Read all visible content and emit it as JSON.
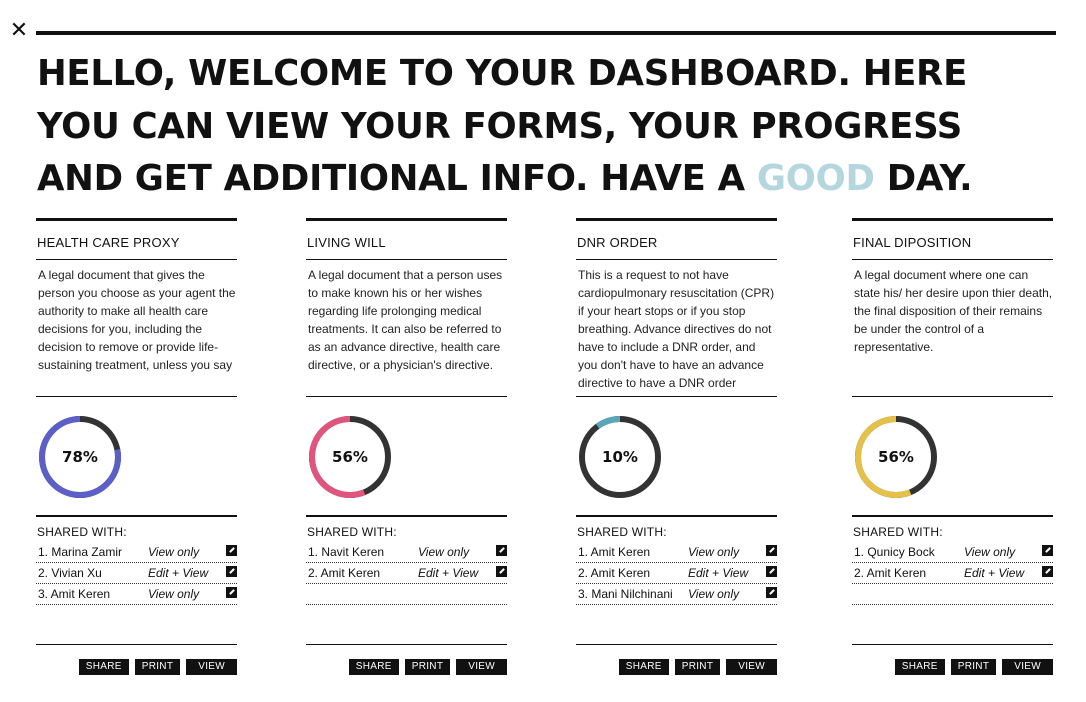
{
  "close_icon": "close-icon",
  "headline": {
    "before": "HELLO, WELCOME TO YOUR DASHBOARD. HERE YOU CAN VIEW YOUR FORMS, YOUR PROGRESS AND GET ADDITIONAL INFO. HAVE A ",
    "accent": "GOOD",
    "after": " DAY."
  },
  "colors": {
    "accent": "#b4d7df",
    "health_care_proxy": "#5b5fc7",
    "living_will": "#e0547e",
    "dnr_order": "#5ba6b8",
    "final_disposition": "#e6c14a",
    "ring_track": "#333333"
  },
  "shared_with_label": "SHARED WITH:",
  "cards": [
    {
      "title": "HEALTH CARE PROXY",
      "description": "A legal document that gives the person you choose as your agent the authority to make all health care decisions for you, including the decision to remove or provide life-sustaining treatment, unless you say",
      "progress": 78,
      "progress_label": "78%",
      "shared": [
        {
          "name": "1. Marina Zamir",
          "permission": "View only"
        },
        {
          "name": "2. Vivian Xu",
          "permission": "Edit + View"
        },
        {
          "name": "3. Amit Keren",
          "permission": "View only"
        }
      ],
      "actions": [
        "SHARE",
        "PRINT",
        "VIEW"
      ]
    },
    {
      "title": "LIVING WILL",
      "description": "A legal document that a person uses to make known his or her wishes regarding life prolonging medical treatments. It can also be referred to as an advance directive, health care directive, or a physician's directive.",
      "progress": 56,
      "progress_label": "56%",
      "shared": [
        {
          "name": "1. Navit Keren",
          "permission": "View only"
        },
        {
          "name": "2. Amit Keren",
          "permission": "Edit + View"
        }
      ],
      "actions": [
        "SHARE",
        "PRINT",
        "VIEW"
      ]
    },
    {
      "title": "DNR ORDER",
      "description": "This is a request to not have cardiopulmonary resuscitation (CPR) if your heart stops or if you stop breathing. Advance directives do not have to include a DNR order, and you don't have to have an advance directive to have a DNR order",
      "progress": 10,
      "progress_label": "10%",
      "shared": [
        {
          "name": "1. Amit Keren",
          "permission": "View only"
        },
        {
          "name": "2. Amit Keren",
          "permission": "Edit + View"
        },
        {
          "name": "3. Mani Nilchinani",
          "permission": "View only"
        }
      ],
      "actions": [
        "SHARE",
        "PRINT",
        "VIEW"
      ]
    },
    {
      "title": "FINAL DIPOSITION",
      "description": "A legal document where one can state his/ her desire upon thier death, the final disposition of their remains be under the control of a representative.",
      "progress": 56,
      "progress_label": "56%",
      "shared": [
        {
          "name": "1. Qunicy Bock",
          "permission": "View only"
        },
        {
          "name": "2. Amit Keren",
          "permission": "Edit + View"
        }
      ],
      "actions": [
        "SHARE",
        "PRINT",
        "VIEW"
      ]
    }
  ]
}
